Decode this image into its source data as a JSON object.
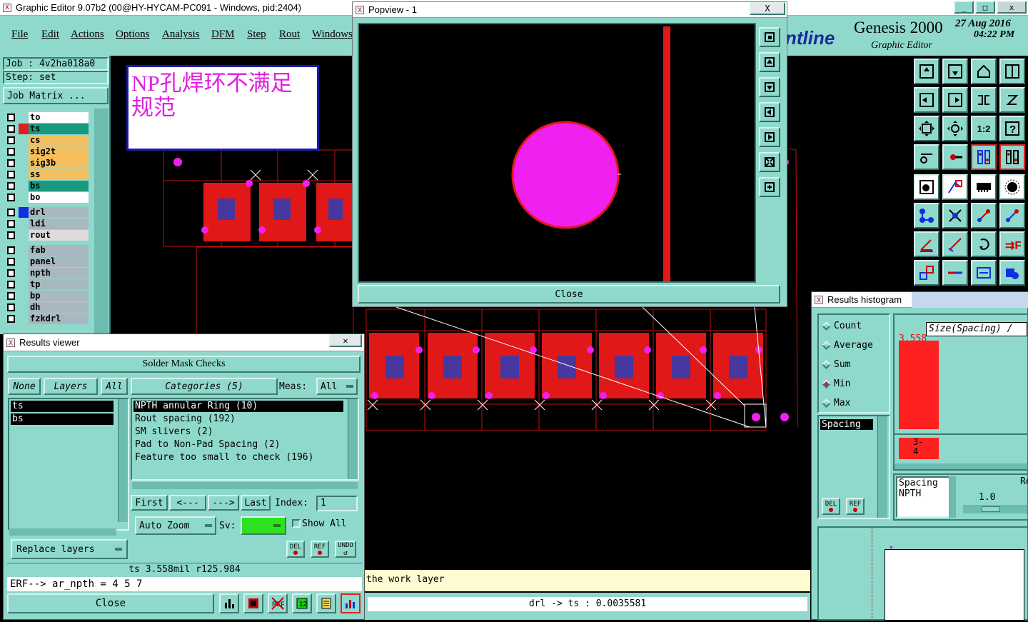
{
  "main_window": {
    "title": "Graphic Editor 9.07b2 (00@HY-HYCAM-PC091 - Windows, pid:2404)",
    "menu": [
      "File",
      "Edit",
      "Actions",
      "Options",
      "Analysis",
      "DFM",
      "Step",
      "Rout",
      "Windows"
    ],
    "brand": {
      "name_partial": "ntline",
      "product": "Genesis 2000",
      "subtitle": "Graphic Editor",
      "date": "27 Aug 2016",
      "time": "04:22 PM"
    },
    "controls": [
      "_",
      "□",
      "x"
    ]
  },
  "job_panel": {
    "job": "Job : 4v2ha018a0",
    "step": "Step: set",
    "job_matrix_label": "Job Matrix ...",
    "layers": [
      {
        "name": "to",
        "color": "#ffffff",
        "mark": ""
      },
      {
        "name": "ts",
        "color": "#189a80",
        "mark": "#e02020"
      },
      {
        "name": "cs",
        "color": "#f2c060",
        "mark": ""
      },
      {
        "name": "sig2t",
        "color": "#f2c060",
        "mark": ""
      },
      {
        "name": "sig3b",
        "color": "#f2c060",
        "mark": ""
      },
      {
        "name": "ss",
        "color": "#f2c060",
        "mark": ""
      },
      {
        "name": "bs",
        "color": "#189a80",
        "mark": ""
      },
      {
        "name": "bo",
        "color": "#ffffff",
        "mark": ""
      },
      {
        "name": "drl",
        "color": "#a8b8c0",
        "mark": "#1030e0"
      },
      {
        "name": "ldi",
        "color": "#a8b8c0",
        "mark": ""
      },
      {
        "name": "rout",
        "color": "#dcdcdc",
        "mark": ""
      },
      {
        "name": "fab",
        "color": "#a8b8c0",
        "mark": ""
      },
      {
        "name": "panel",
        "color": "#a8b8c0",
        "mark": ""
      },
      {
        "name": "npth",
        "color": "#a8b8c0",
        "mark": ""
      },
      {
        "name": "tp",
        "color": "#a8b8c0",
        "mark": ""
      },
      {
        "name": "bp",
        "color": "#a8b8c0",
        "mark": ""
      },
      {
        "name": "dh",
        "color": "#a8b8c0",
        "mark": ""
      },
      {
        "name": "fzkdrl",
        "color": "#a8b8c0",
        "mark": ""
      }
    ]
  },
  "annotation": {
    "text": "NP孔焊环不满足规范"
  },
  "popview": {
    "title": "Popview - 1",
    "close_label": "Close",
    "close_x": "X"
  },
  "results_viewer": {
    "title": "Results viewer",
    "header": "Solder Mask Checks",
    "none_label": "None",
    "layers_label": "Layers",
    "all_label": "All",
    "categories_label": "Categories (5)",
    "meas_label": "Meas:",
    "meas_value": "All",
    "layer_items": [
      "ts",
      "bs"
    ],
    "categories": [
      "NPTH annular Ring (10)",
      "Rout spacing (192)",
      "SM slivers (2)",
      "Pad to Non-Pad Spacing (2)",
      "Feature too small to check (196)"
    ],
    "first_label": "First",
    "prev_label": "<---",
    "next_label": "--->",
    "last_label": "Last",
    "index_label": "Index:",
    "index_value": "1",
    "auto_zoom_label": "Auto Zoom",
    "sv_label": "Sv:",
    "show_all_label": "Show All",
    "replace_layers_label": "Replace layers",
    "del_label": "DEL",
    "ref_label": "REF",
    "undo_label": "UNDO",
    "status_line": "ts 3.558mil  r125.984",
    "erf_line": "ERF--> ar_npth = 4 5 7",
    "close_label": "Close"
  },
  "status": {
    "work_layer_msg": "the work layer",
    "measure": "drl -> ts : 0.0035581"
  },
  "histogram": {
    "title": "Results histogram",
    "options": [
      "Count",
      "Average",
      "Sum",
      "Min",
      "Max"
    ],
    "selected_option": "Min",
    "axis_title": "Size(Spacing) /",
    "bar_value": "3.558",
    "bar_fraction": 1.0,
    "bin_label_top": "3-",
    "bin_label_bottom": "4",
    "list_item": "Spacing",
    "detail_lines": [
      "Spacing",
      "NPTH"
    ],
    "ratio_label": "Re",
    "ratio_value": "1.0",
    "del_label": "DEL",
    "ref_label": "REF"
  },
  "colors": {
    "teal": "#8fd8cc",
    "copper": "#e01818",
    "drill": "#f020f0"
  }
}
